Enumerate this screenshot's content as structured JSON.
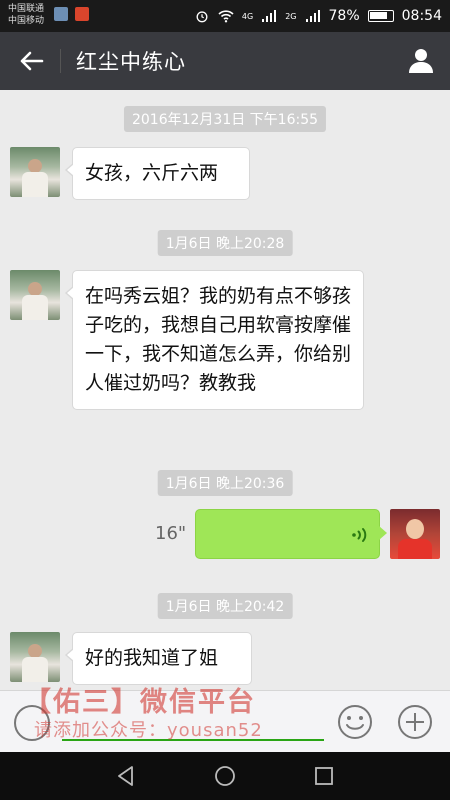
{
  "status_bar": {
    "carrier_1": "中国联通",
    "carrier_2": "中国移动",
    "network_1": "4G",
    "network_2": "2G",
    "battery": "78%",
    "time": "08:54"
  },
  "title_bar": {
    "title": "红尘中练心"
  },
  "messages": [
    {
      "timestamp": "2016年12月31日 下午16:55",
      "side": "received",
      "text": "女孩，六斤六两"
    },
    {
      "timestamp": "1月6日 晚上20:28",
      "side": "received",
      "text": "在吗秀云姐？我的奶有点不够孩子吃的，我想自己用软膏按摩催一下，我不知道怎么弄，你给别人催过奶吗？教教我"
    },
    {
      "timestamp": "1月6日 晚上20:36",
      "side": "sent",
      "voice_duration": "16\""
    },
    {
      "timestamp": "1月6日 晚上20:42",
      "side": "received",
      "text": "好的我知道了姐"
    }
  ],
  "watermark": {
    "title": "【佑三】微信平台",
    "subtitle": "请添加公众号：yousan52"
  },
  "colors": {
    "title_bar": "#393a3f",
    "voice_bubble": "#9fe657",
    "chat_bg": "#ebebeb"
  }
}
